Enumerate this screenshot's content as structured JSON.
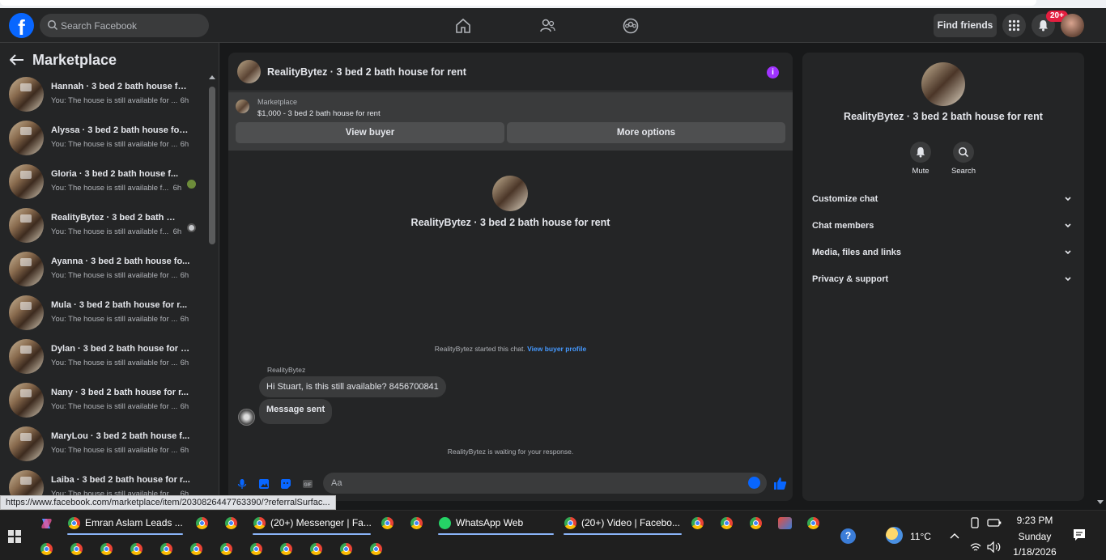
{
  "header": {
    "search_placeholder": "Search Facebook",
    "find_friends": "Find friends",
    "notification_badge": "20+"
  },
  "sidebar": {
    "title": "Marketplace",
    "items": [
      {
        "name": "Hannah · 3 bed 2 bath house fo...",
        "snippet": "You: The house is still available for ...",
        "time": "6h",
        "status": ""
      },
      {
        "name": "Alyssa · 3 bed 2 bath house for ...",
        "snippet": "You: The house is still available for ...",
        "time": "6h",
        "status": ""
      },
      {
        "name": "Gloria · 3 bed 2 bath house f...",
        "snippet": "You: The house is still available f...",
        "time": "6h",
        "status": "unread"
      },
      {
        "name": "RealityBytez · 3 bed 2 bath h...",
        "snippet": "You: The house is still available f...",
        "time": "6h",
        "status": "seen"
      },
      {
        "name": "Ayanna · 3 bed 2 bath house fo...",
        "snippet": "You: The house is still available for ...",
        "time": "6h",
        "status": ""
      },
      {
        "name": "Mula · 3 bed 2 bath house for r...",
        "snippet": "You: The house is still available for ...",
        "time": "6h",
        "status": ""
      },
      {
        "name": "Dylan · 3 bed 2 bath house for r...",
        "snippet": "You: The house is still available for ...",
        "time": "6h",
        "status": ""
      },
      {
        "name": "Nany · 3 bed 2 bath house for r...",
        "snippet": "You: The house is still available for ...",
        "time": "6h",
        "status": ""
      },
      {
        "name": "MaryLou · 3 bed 2 bath house f...",
        "snippet": "You: The house is still available for ...",
        "time": "6h",
        "status": ""
      },
      {
        "name": "Laiba · 3 bed 2 bath house for r...",
        "snippet": "You: The house is still available for ...",
        "time": "6h",
        "status": ""
      }
    ]
  },
  "chat": {
    "title": "RealityBytez · 3 bed 2 bath house for rent",
    "banner_label": "Marketplace",
    "banner_price": "$1,000 - 3 bed 2 bath house for rent",
    "view_buyer": "View buyer",
    "more_options": "More options",
    "center_name": "RealityBytez · 3 bed 2 bath house for rent",
    "started_text": "RealityBytez started this chat.",
    "view_buyer_profile": "View buyer profile",
    "sender": "RealityBytez",
    "message_1": "Hi Stuart, is this still available? 8456700841",
    "message_2": "Message sent",
    "waiting": "RealityBytez is waiting for your response.",
    "composer_placeholder": "Aa"
  },
  "info_panel": {
    "name": "RealityBytez · 3 bed 2 bath house for rent",
    "mute": "Mute",
    "search": "Search",
    "rows": [
      "Customize chat",
      "Chat members",
      "Media, files and links",
      "Privacy & support"
    ]
  },
  "url_tooltip": "https://www.facebook.com/marketplace/item/2030826447763390/?referralSurfac...",
  "taskbar": {
    "apps": [
      "Emran Aslam Leads ...",
      "(20+) Messenger | Fa...",
      "WhatsApp Web",
      "(20+) Video | Facebo..."
    ],
    "temperature": "11°C",
    "time": "9:23 PM",
    "day": "Sunday",
    "date": "1/18/2026"
  }
}
